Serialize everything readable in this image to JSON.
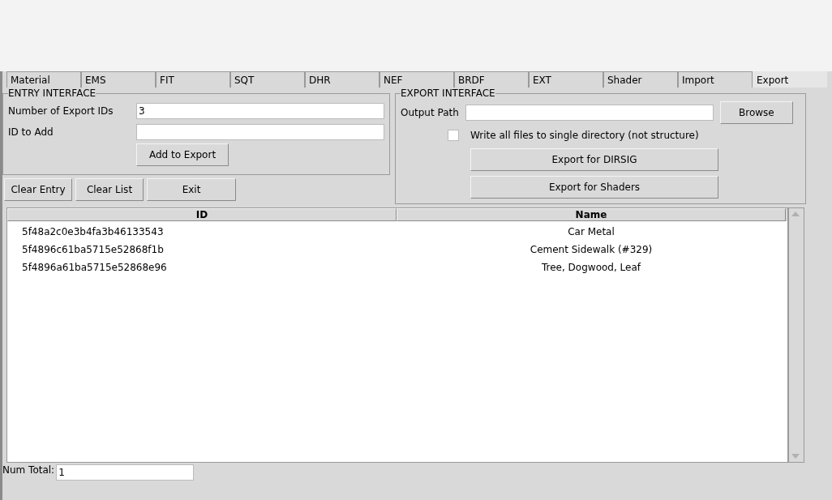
{
  "tabs": [
    {
      "label": "Material",
      "selected": false
    },
    {
      "label": "EMS",
      "selected": false
    },
    {
      "label": "FIT",
      "selected": false
    },
    {
      "label": "SQT",
      "selected": false
    },
    {
      "label": "DHR",
      "selected": false
    },
    {
      "label": "NEF",
      "selected": false
    },
    {
      "label": "BRDF",
      "selected": false
    },
    {
      "label": "EXT",
      "selected": false
    },
    {
      "label": "Shader",
      "selected": false
    },
    {
      "label": "Import",
      "selected": false
    },
    {
      "label": "Export",
      "selected": true
    }
  ],
  "entry_interface": {
    "title": "ENTRY INTERFACE",
    "fields": [
      {
        "label": "Number of Export IDs",
        "value": "3"
      },
      {
        "label": "ID to Add"
      }
    ],
    "add_button": "Add to Export"
  },
  "actions": [
    "Clear Entry",
    "Clear List",
    "Exit"
  ],
  "export_interface": {
    "title": "EXPORT INTERFACE",
    "output_path": {
      "label": "Output Path"
    },
    "browse_button": "Browse",
    "single_directory": {
      "label": "Write all files to single directory (not structure)",
      "checked": false
    },
    "buttons": [
      "Export for DIRSIG",
      "Export for Shaders"
    ]
  },
  "table": {
    "columns": [
      "ID",
      "Name"
    ],
    "rows": [
      {
        "id": "5f48a2c0e3b4fa3b46133543",
        "name": "Car Metal"
      },
      {
        "id": "5f4896c61ba5715e52868f1b",
        "name": "Cement Sidewalk (#329)"
      },
      {
        "id": "5f4896a61ba5715e52868e96",
        "name": "Tree, Dogwood, Leaf"
      }
    ]
  },
  "num_total": {
    "label": "Num Total:",
    "value": "1"
  }
}
